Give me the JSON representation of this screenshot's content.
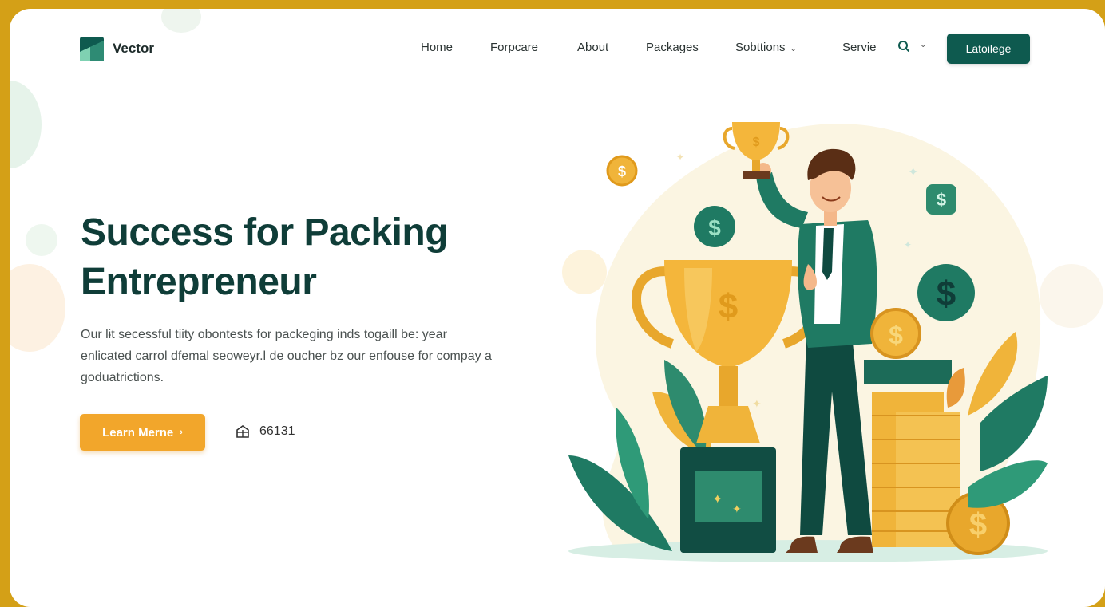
{
  "brand": {
    "name": "Vector"
  },
  "nav": {
    "items": [
      {
        "label": "Home"
      },
      {
        "label": "Forpcare"
      },
      {
        "label": "About"
      },
      {
        "label": "Packages"
      },
      {
        "label": "Sobttions",
        "dropdown": true
      },
      {
        "label": "Servie"
      }
    ],
    "search_icon": "search-icon",
    "cta_label": "Latoilege"
  },
  "hero": {
    "headline_line1": "Success for Packing",
    "headline_line2": "Entrepreneur",
    "description": "Our lɨt secessful tiity obontests for packeging inds togaill be: year enlicated carrol dfemal seoweyr.l de oucher bz our enfouse for compay a goduatrictions.",
    "button_label": "Learn Merne",
    "button_arrow": "›",
    "stat_icon": "building-icon",
    "stat_value": "66131"
  },
  "colors": {
    "outer_frame": "#d4a017",
    "brand_green": "#0e5a4f",
    "headline": "#0f3d38",
    "accent_orange": "#f2a62b",
    "gold": "#f0b43a"
  }
}
